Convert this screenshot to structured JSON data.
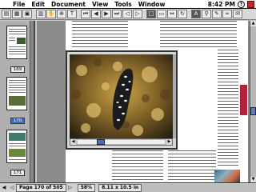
{
  "menubar": {
    "items": [
      "File",
      "Edit",
      "Document",
      "View",
      "Tools",
      "Window"
    ],
    "clock": "8:42 PM"
  },
  "toolbar": {
    "buttons": [
      {
        "name": "open-icon",
        "glyph": "▤"
      },
      {
        "name": "print-icon",
        "glyph": "▦"
      },
      {
        "name": "save-icon",
        "glyph": "▣"
      },
      {
        "name": "thumbnails-icon",
        "glyph": "▥"
      },
      {
        "name": "hand-tool-icon",
        "glyph": "✋"
      },
      {
        "name": "zoom-tool-icon",
        "glyph": "⊕"
      },
      {
        "name": "select-text-icon",
        "glyph": "T"
      },
      {
        "name": "first-page-icon",
        "glyph": "⏮"
      },
      {
        "name": "prev-page-icon",
        "glyph": "◀"
      },
      {
        "name": "next-page-icon",
        "glyph": "▶"
      },
      {
        "name": "last-page-icon",
        "glyph": "⏭"
      },
      {
        "name": "go-back-icon",
        "glyph": "◁"
      },
      {
        "name": "go-forward-icon",
        "glyph": "▷"
      },
      {
        "name": "actual-size-icon",
        "glyph": "□"
      },
      {
        "name": "fit-page-icon",
        "glyph": "▭"
      },
      {
        "name": "fit-width-icon",
        "glyph": "⇔"
      },
      {
        "name": "rotate-icon",
        "glyph": "↻"
      },
      {
        "name": "find-icon",
        "glyph": "A"
      },
      {
        "name": "search-icon",
        "glyph": "⚲"
      },
      {
        "name": "bookmark-icon",
        "glyph": "✎"
      },
      {
        "name": "link-icon",
        "glyph": "∞"
      },
      {
        "name": "note-icon",
        "glyph": "✉"
      }
    ]
  },
  "thumbnails": {
    "labels": [
      "169",
      "170",
      "171"
    ],
    "selected_index": 1
  },
  "statusbar": {
    "page": "Page 170 of 505",
    "zoom": "58%",
    "size": "8.11 x 10.5 in"
  },
  "colors": {
    "accent": "#3a6fd0",
    "red_tab": "#b2203a"
  }
}
